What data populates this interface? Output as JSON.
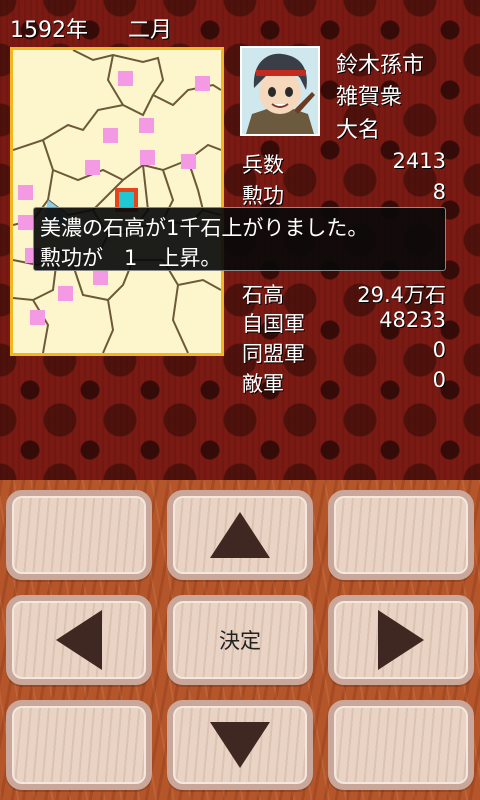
{
  "header": {
    "year": "1592年",
    "month": "二月"
  },
  "officer": {
    "name": "鈴木孫市",
    "clan": "雑賀衆",
    "rank": "大名"
  },
  "stats_upper": [
    {
      "label": "兵数",
      "value": "2413"
    },
    {
      "label": "勲功",
      "value": "8"
    }
  ],
  "stats_lower": [
    {
      "label": "石高",
      "value": "29.4万石"
    },
    {
      "label": "自国軍",
      "value": "48233"
    },
    {
      "label": "同盟軍",
      "value": "0"
    },
    {
      "label": "敵軍",
      "value": "0"
    }
  ],
  "message": {
    "line1": "美濃の石高が1千石上がりました。",
    "line2": "勲功が　1　上昇。"
  },
  "controls": {
    "ok_label": "決定"
  },
  "colors": {
    "map_bg": "#fdf6cc",
    "map_border": "#f2b71e",
    "province_marker": "#f49ae5",
    "selected_province": "#1fc8d4",
    "selection_outline": "#e8441a"
  }
}
